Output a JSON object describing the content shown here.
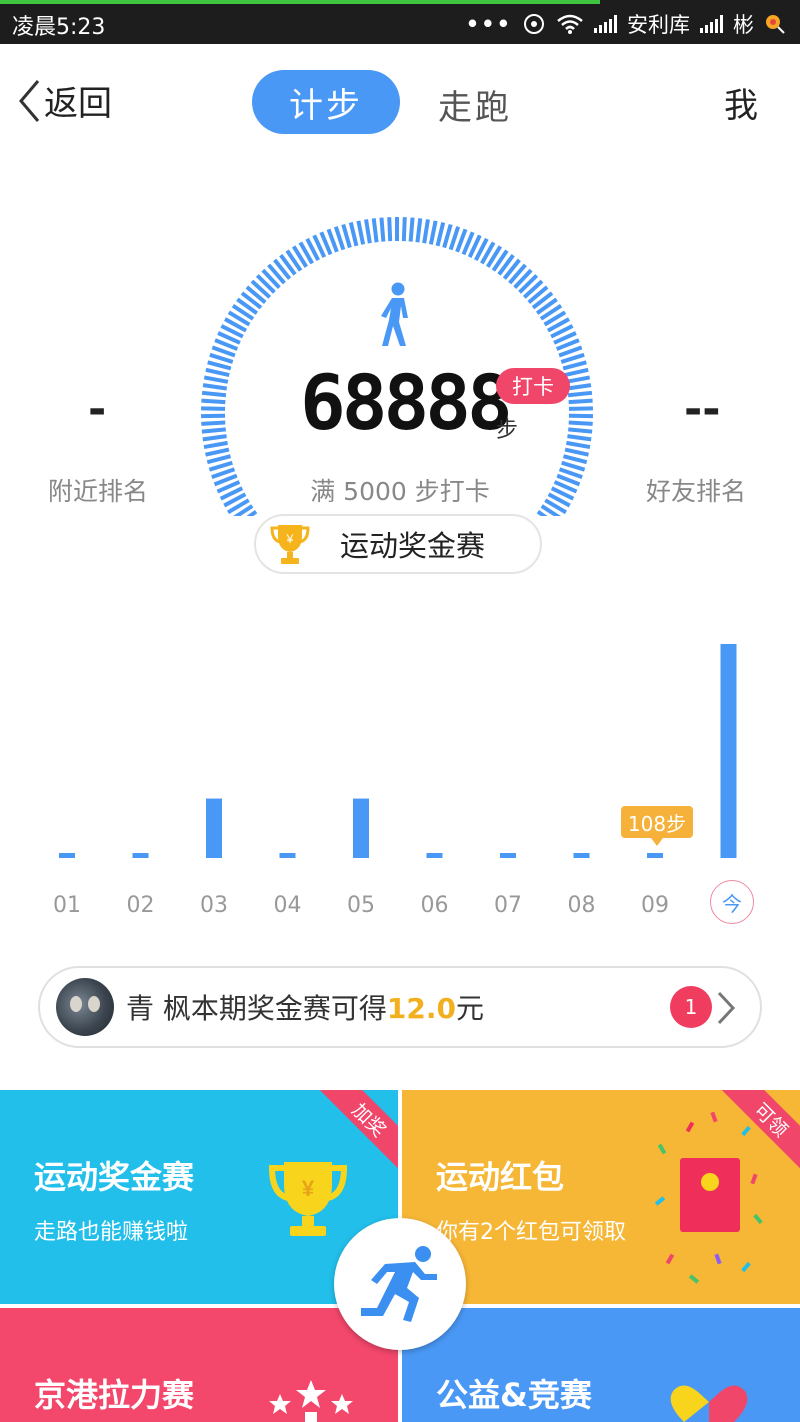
{
  "status_bar": {
    "time": "凌晨5:23",
    "dots": "•••",
    "carrier": "安利库",
    "carrier2": "彬"
  },
  "nav": {
    "back_label": "返回",
    "tab_step": "计步",
    "tab_run": "走跑",
    "me_label": "我"
  },
  "gauge": {
    "steps": "68888",
    "unit": "步",
    "checkin": "打卡",
    "goal": "满 5000 步打卡",
    "nearby_value": "-",
    "nearby_label": "附近排名",
    "friends_value": "--",
    "friends_label": "好友排名",
    "prize_label": "运动奖金赛"
  },
  "chart_data": {
    "type": "bar",
    "categories": [
      "01",
      "02",
      "03",
      "04",
      "05",
      "06",
      "07",
      "08",
      "09",
      "今"
    ],
    "values": [
      108,
      108,
      2000,
      108,
      2000,
      108,
      108,
      108,
      108,
      7200
    ],
    "tooltip": "108步",
    "colors": {
      "bar": "#4a98f5",
      "tick": "#999999"
    }
  },
  "bonus": {
    "name": "青 枫",
    "text": "本期奖金赛可得",
    "amount": "12.0",
    "currency": "元",
    "badge": "1"
  },
  "tiles": {
    "a": {
      "title": "运动奖金赛",
      "subtitle": "走路也能赚钱啦",
      "ribbon": "加奖"
    },
    "b": {
      "title": "运动红包",
      "subtitle": "你有2个红包可领取",
      "ribbon": "可领"
    },
    "c": {
      "title": "京港拉力赛"
    },
    "d": {
      "title": "公益&竞赛"
    }
  },
  "colors": {
    "accent": "#4a98f5",
    "pink": "#f0466a",
    "gold": "#f2b01e",
    "cyan": "#21bfea",
    "orange": "#f6b636"
  }
}
